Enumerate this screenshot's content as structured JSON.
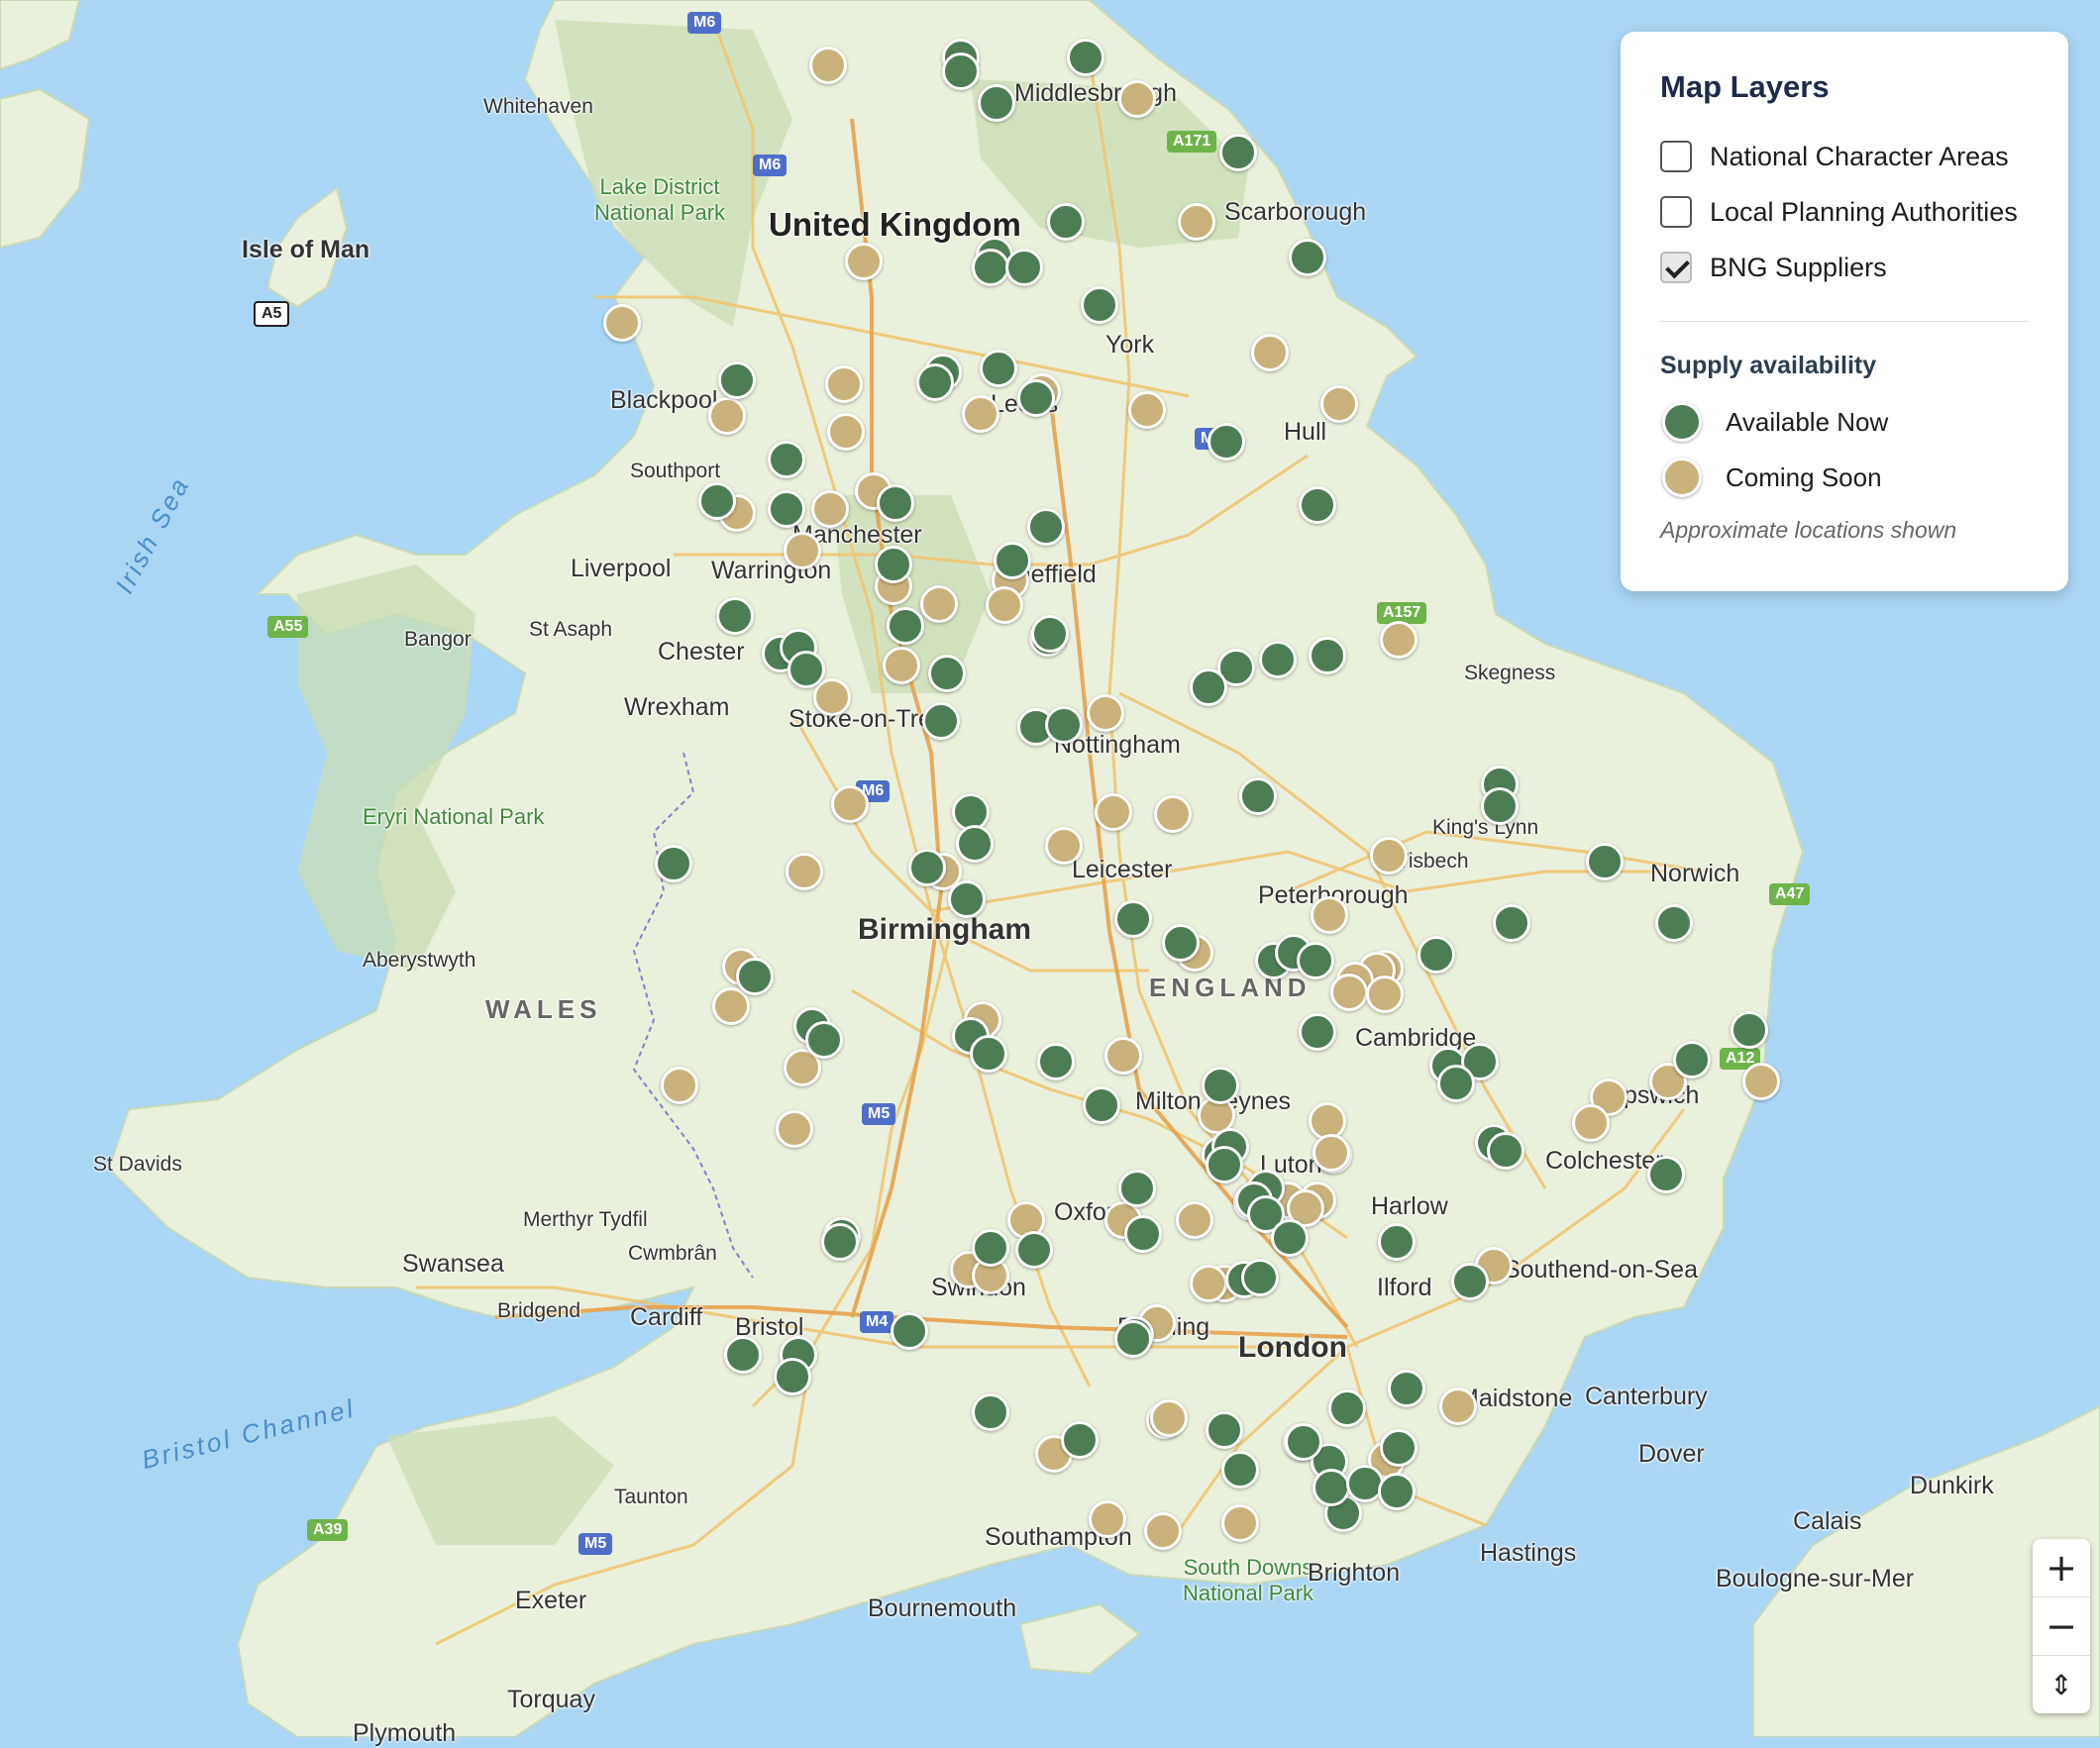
{
  "panel": {
    "title": "Map Layers",
    "layers": [
      {
        "label": "National Character Areas",
        "checked": false
      },
      {
        "label": "Local Planning Authorities",
        "checked": false
      },
      {
        "label": "BNG Suppliers",
        "checked": true
      }
    ],
    "legend_title": "Supply availability",
    "legend": [
      {
        "label": "Available Now",
        "color": "#4c7d55"
      },
      {
        "label": "Coming Soon",
        "color": "#c9b27b"
      }
    ],
    "note": "Approximate locations shown"
  },
  "zoom": {
    "in": "+",
    "out": "−",
    "compass": "⇕"
  },
  "map_labels": {
    "country": "United Kingdom",
    "region_england": "ENGLAND",
    "region_wales": "WALES",
    "isle_of_man": "Isle of Man",
    "irish_sea": "Irish Sea",
    "bristol_channel": "Bristol Channel",
    "lake_district": "Lake District National Park",
    "eryri": "Eryri National Park",
    "south_downs": "South Downs National Park",
    "towns": [
      "Whitehaven",
      "Middlesbrough",
      "Scarborough",
      "York",
      "Blackpool",
      "Leeds",
      "Hull",
      "Southport",
      "Manchester",
      "Liverpool",
      "Warrington",
      "Sheffield",
      "Bangor",
      "St Asaph",
      "Chester",
      "Skegness",
      "Wrexham",
      "Stoke-on-Trent",
      "Nottingham",
      "King's Lynn",
      "Wisbech",
      "Leicester",
      "Norwich",
      "Peterborough",
      "Birmingham",
      "Aberystwyth",
      "Cambridge",
      "Ipswich",
      "Milton Keynes",
      "Colchester",
      "St Davids",
      "Luton",
      "Oxford",
      "Harlow",
      "Merthyr Tydfil",
      "Swansea",
      "Cwmbrân",
      "Southend-on-Sea",
      "Swindon",
      "Ilford",
      "Bridgend",
      "Cardiff",
      "Bristol",
      "Reading",
      "London",
      "Maidstone",
      "Canterbury",
      "Taunton",
      "Dover",
      "Dunkirk",
      "Calais",
      "Southampton",
      "Hastings",
      "Exeter",
      "Bournemouth",
      "Brighton",
      "Boulogne-sur-Mer",
      "Torquay",
      "Plymouth"
    ]
  },
  "road_shields": [
    "M6",
    "M6",
    "A171",
    "M62",
    "A55",
    "A157",
    "M6",
    "A47",
    "A12",
    "M5",
    "M4",
    "A39",
    "M5",
    "A5",
    "A55"
  ],
  "suppliers": {
    "available_now_count": 111,
    "coming_soon_count": 75
  }
}
